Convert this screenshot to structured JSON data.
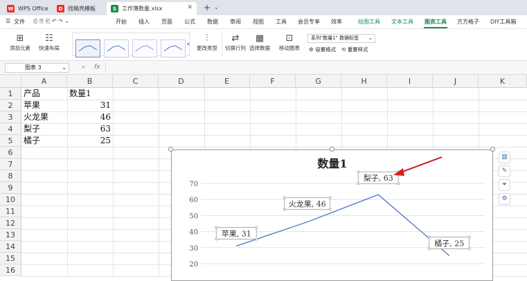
{
  "tabs": [
    {
      "label": "WPS Office",
      "icon": "W",
      "color": "#e8312f"
    },
    {
      "label": "找稿壳模板",
      "icon": "D",
      "color": "#e8312f"
    },
    {
      "label": "工作簿数量.xlsx",
      "icon": "S",
      "color": "#1e8b4f"
    }
  ],
  "menu": {
    "file": "文件",
    "items": [
      "开始",
      "插入",
      "页面",
      "公式",
      "数据",
      "审阅",
      "视图",
      "工具",
      "会员专享",
      "效率"
    ],
    "context": [
      "绘图工具",
      "文本工具",
      "图表工具"
    ],
    "extra": [
      "方方格子",
      "DIY工具箱"
    ]
  },
  "ribbon": {
    "add_element": "添加元素",
    "quick_layout": "快速布局",
    "change_type": "更改类型",
    "switch_rowcol": "切换行列",
    "select_data": "选择数据",
    "move_chart": "移动图表",
    "series_select": "系列\"数量1\" 数据标签",
    "set_format": "设置格式",
    "reset_style": "重置样式"
  },
  "formula_bar": {
    "name_box": "图表 3",
    "fx": "fx"
  },
  "columns": [
    "A",
    "B",
    "C",
    "D",
    "E",
    "F",
    "G",
    "H",
    "I",
    "J",
    "K"
  ],
  "rows": [
    "1",
    "2",
    "3",
    "4",
    "5",
    "6",
    "7",
    "8",
    "9",
    "10",
    "11",
    "12",
    "13",
    "14",
    "15",
    "16"
  ],
  "sheet": {
    "header": {
      "a": "产品",
      "b": "数量1"
    },
    "data": [
      {
        "a": "苹果",
        "b": "31"
      },
      {
        "a": "火龙果",
        "b": "46"
      },
      {
        "a": "梨子",
        "b": "63"
      },
      {
        "a": "橘子",
        "b": "25"
      }
    ]
  },
  "chart_data": {
    "type": "line",
    "title": "数量1",
    "categories": [
      "苹果",
      "火龙果",
      "梨子",
      "橘子"
    ],
    "series": [
      {
        "name": "数量1",
        "values": [
          31,
          46,
          63,
          25
        ],
        "color": "#4472c4"
      }
    ],
    "data_labels": [
      "苹果, 31",
      "火龙果, 46",
      "梨子, 63",
      "橘子, 25"
    ],
    "yticks": [
      "70",
      "60",
      "50",
      "40",
      "30",
      "20"
    ],
    "ylim": [
      10,
      70
    ],
    "grid": true,
    "annotation_arrow_color": "#cc2020"
  }
}
